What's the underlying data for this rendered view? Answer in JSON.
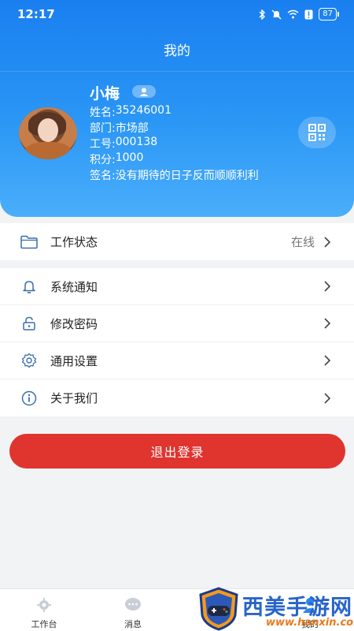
{
  "status_bar": {
    "time": "12:17",
    "battery": "87"
  },
  "header": {
    "title": "我的"
  },
  "profile": {
    "name": "小梅",
    "fields": [
      {
        "label": "姓名:",
        "value": "35246001"
      },
      {
        "label": "部门:",
        "value": "市场部"
      },
      {
        "label": "工号:",
        "value": "000138"
      },
      {
        "label": "积分:",
        "value": "1000"
      },
      {
        "label": "签名:",
        "value": "没有期待的日子反而顺顺利利"
      }
    ]
  },
  "menu": {
    "status": {
      "label": "工作状态",
      "value": "在线",
      "icon": "folder-icon"
    },
    "items": [
      {
        "label": "系统通知",
        "icon": "bell-icon"
      },
      {
        "label": "修改密码",
        "icon": "lock-icon"
      },
      {
        "label": "通用设置",
        "icon": "gear-icon"
      },
      {
        "label": "关于我们",
        "icon": "info-icon"
      }
    ]
  },
  "logout": {
    "label": "退出登录"
  },
  "tabbar": {
    "tabs": [
      {
        "label": "工作台",
        "icon": "workbench-icon"
      },
      {
        "label": "消息",
        "icon": "message-icon"
      },
      {
        "label": "我的",
        "icon": "profile-icon"
      }
    ]
  },
  "watermark": {
    "text": "西美手游网",
    "url": "www.hanxin.com"
  },
  "colors": {
    "primary": "#1a7ff0",
    "logout": "#e0342e",
    "icon_blue": "#3a8fd8"
  }
}
